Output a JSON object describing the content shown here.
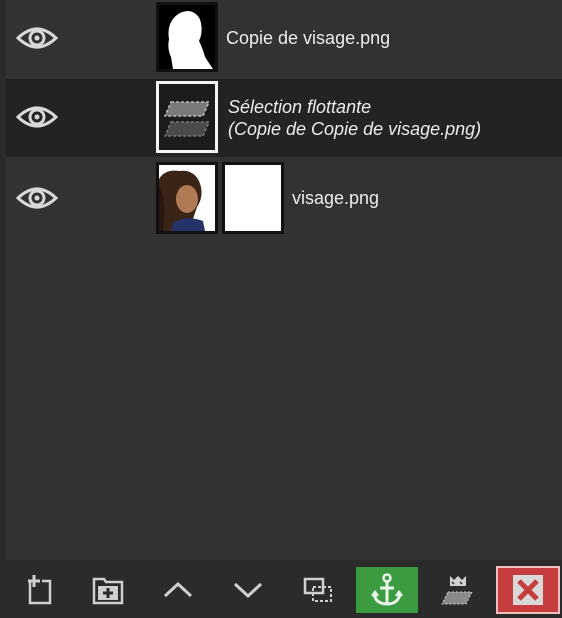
{
  "layers": [
    {
      "name": "Copie de visage.png",
      "visible": true,
      "selected": false
    },
    {
      "name_line1": "Sélection flottante",
      "name_line2": "(Copie de Copie de visage.png)",
      "visible": true,
      "selected": true,
      "floating": true
    },
    {
      "name": "visage.png",
      "visible": true,
      "selected": false,
      "has_mask": true
    }
  ],
  "icons": {
    "visibility": "eye-icon",
    "new_layer": "new-layer-icon",
    "new_group": "new-layer-group-icon",
    "raise": "chevron-up-icon",
    "lower": "chevron-down-icon",
    "duplicate": "duplicate-layer-icon",
    "anchor": "anchor-icon",
    "merge_down": "merge-down-icon",
    "delete": "delete-icon"
  },
  "colors": {
    "panel_bg": "#323232",
    "selected_row_bg": "#232323",
    "anchor_button_bg": "#3c9a40",
    "delete_button_bg": "#c73d3d"
  }
}
